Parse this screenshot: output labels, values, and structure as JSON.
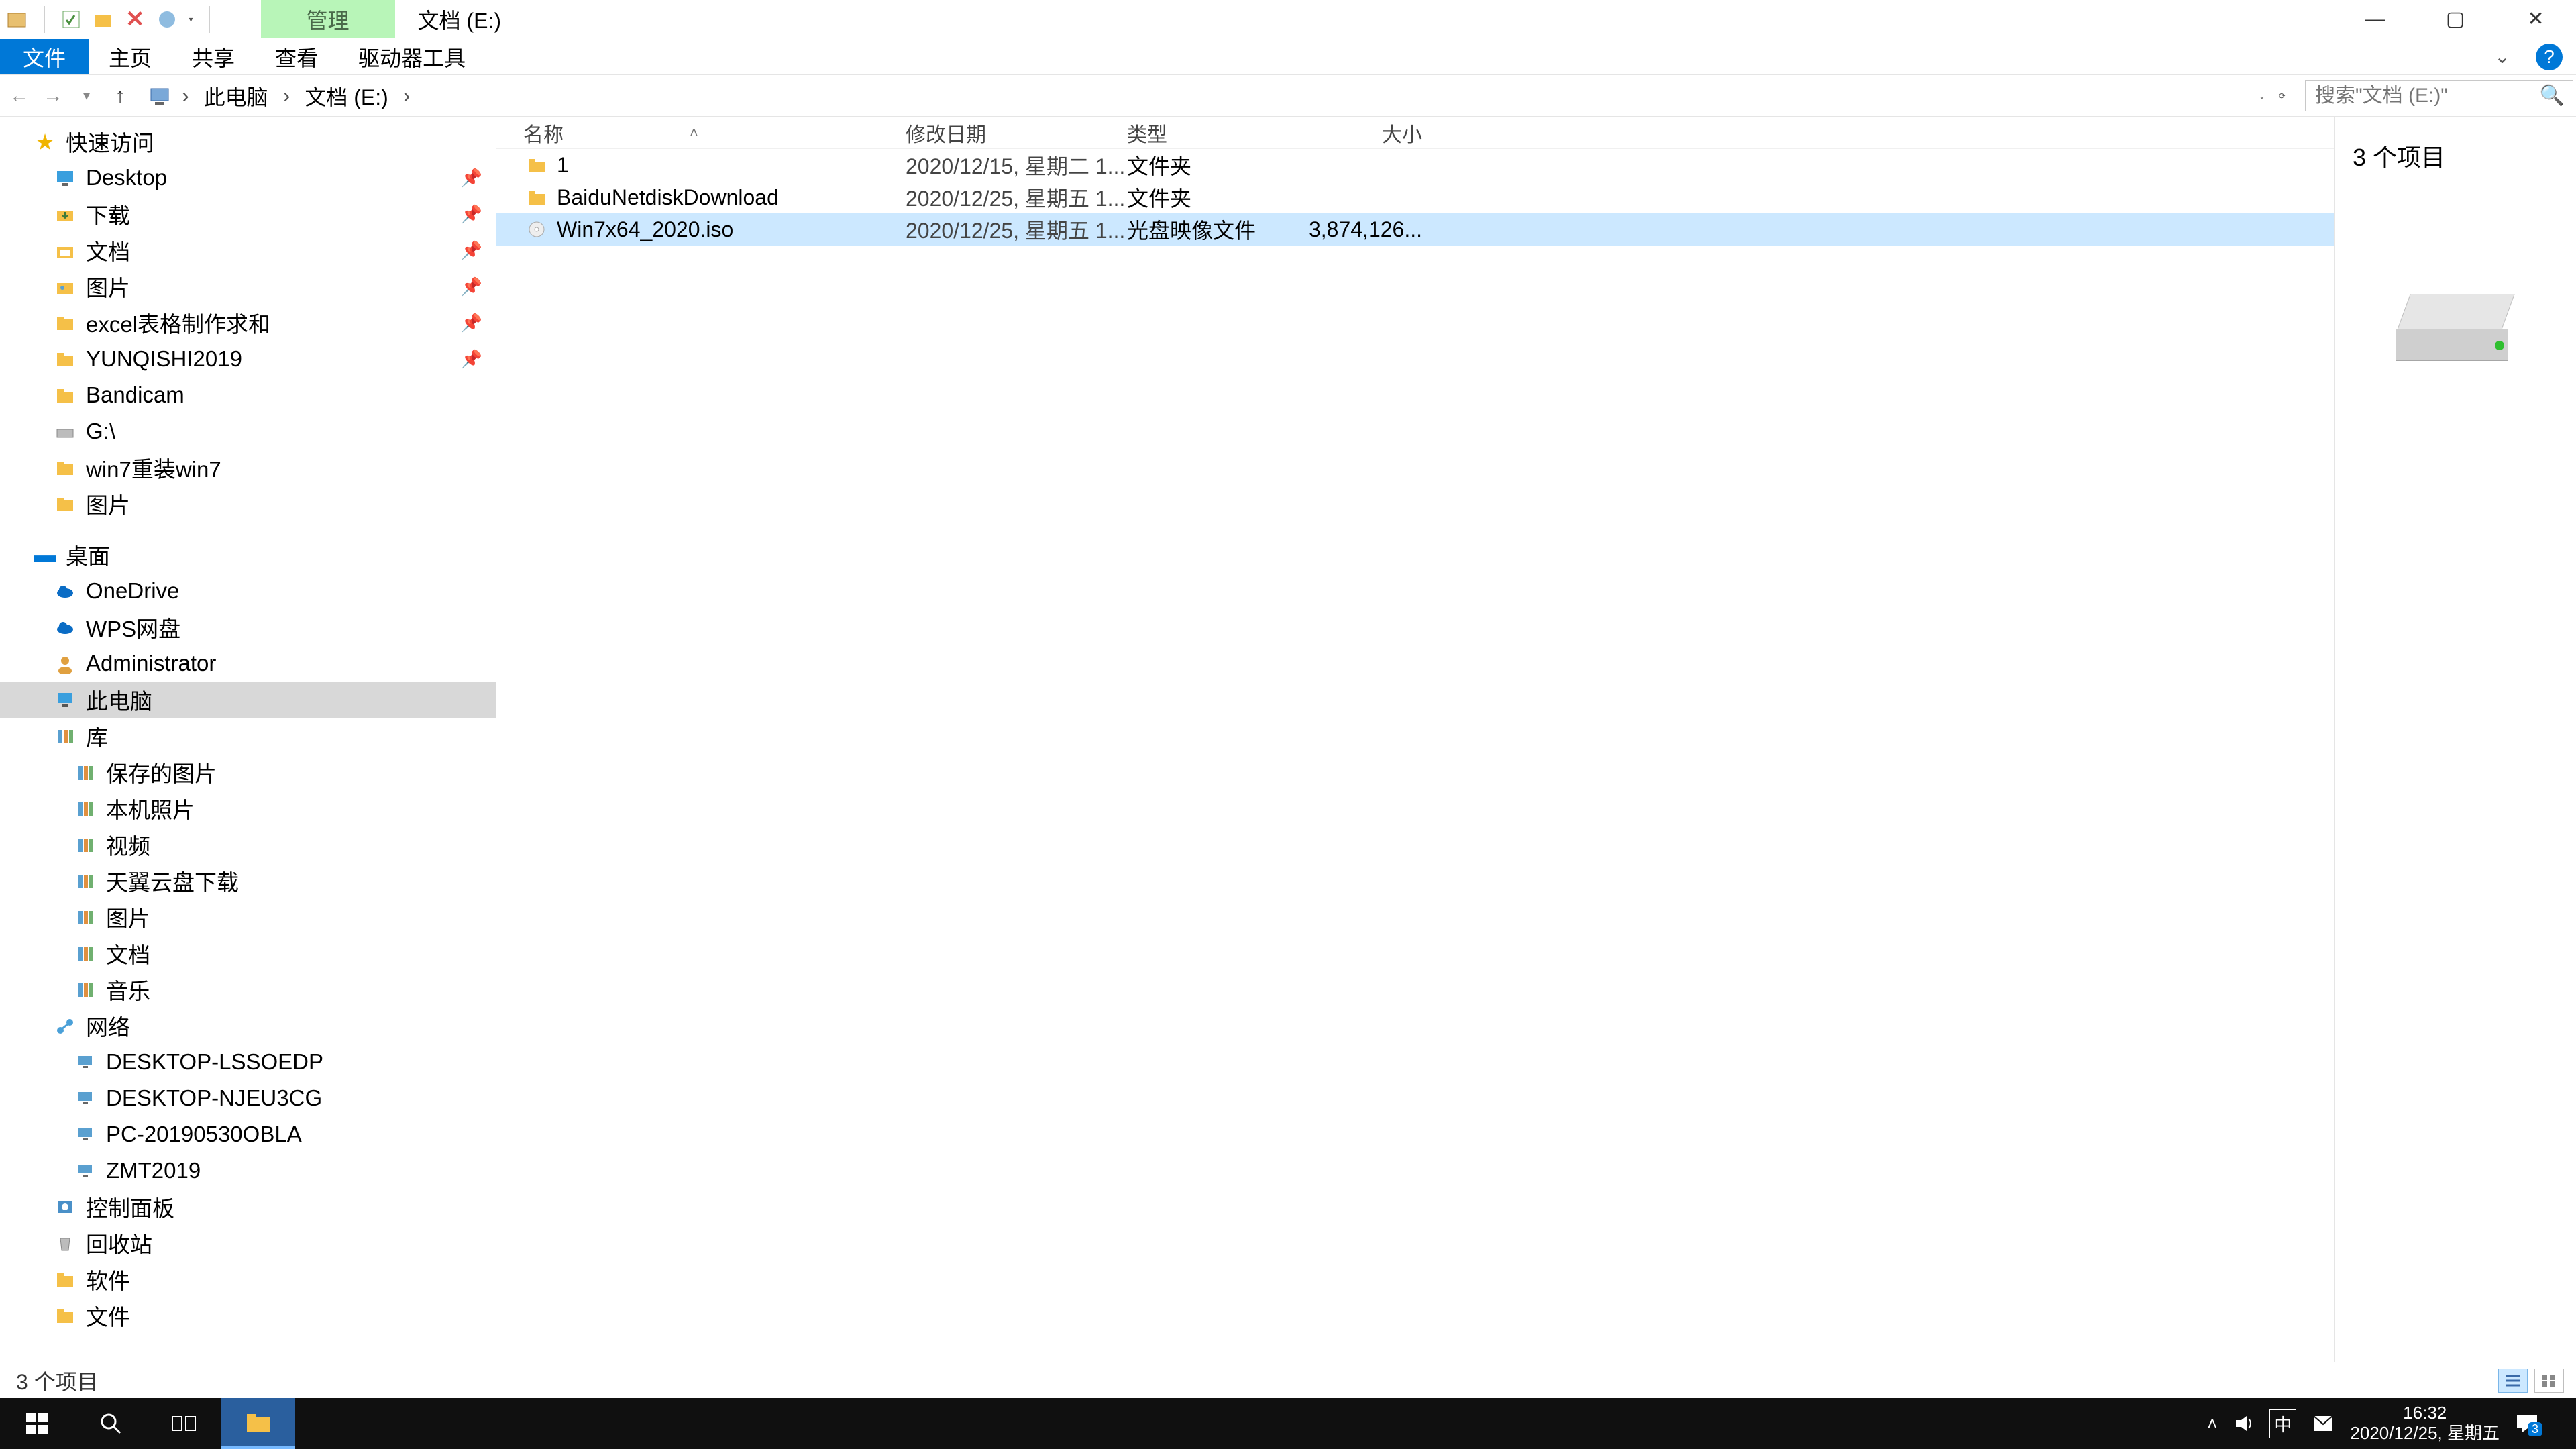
{
  "window": {
    "ctx_tab": "管理",
    "title": "文档 (E:)",
    "controls": {
      "min": "—",
      "max": "▢",
      "close": "✕"
    }
  },
  "menu": {
    "file": "文件",
    "home": "主页",
    "share": "共享",
    "view": "查看",
    "drive": "驱动器工具"
  },
  "breadcrumb": {
    "root": "此电脑",
    "here": "文档 (E:)",
    "sep": "›"
  },
  "search": {
    "placeholder": "搜索\"文档 (E:)\""
  },
  "nav": {
    "quick": "快速访问",
    "pinned": [
      {
        "l": "Desktop",
        "ico": "desktop"
      },
      {
        "l": "下载",
        "ico": "down"
      },
      {
        "l": "文档",
        "ico": "doc"
      },
      {
        "l": "图片",
        "ico": "pic"
      },
      {
        "l": "excel表格制作求和",
        "ico": "folder"
      },
      {
        "l": "YUNQISHI2019",
        "ico": "folder"
      }
    ],
    "recent": [
      {
        "l": "Bandicam",
        "ico": "folder"
      },
      {
        "l": "G:\\",
        "ico": "drive"
      },
      {
        "l": "win7重装win7",
        "ico": "folder"
      },
      {
        "l": "图片",
        "ico": "folder"
      }
    ],
    "desktop_root": "桌面",
    "desktop": [
      {
        "l": "OneDrive",
        "ico": "cloud",
        "c": "#0a6cc5"
      },
      {
        "l": "WPS网盘",
        "ico": "cloud",
        "c": "#0a6cc5"
      },
      {
        "l": "Administrator",
        "ico": "user"
      },
      {
        "l": "此电脑",
        "ico": "pc",
        "sel": true
      },
      {
        "l": "库",
        "ico": "lib"
      }
    ],
    "libs": [
      {
        "l": "保存的图片"
      },
      {
        "l": "本机照片"
      },
      {
        "l": "视频"
      },
      {
        "l": "天翼云盘下载"
      },
      {
        "l": "图片"
      },
      {
        "l": "文档"
      },
      {
        "l": "音乐"
      }
    ],
    "network": "网络",
    "net_items": [
      {
        "l": "DESKTOP-LSSOEDP"
      },
      {
        "l": "DESKTOP-NJEU3CG"
      },
      {
        "l": "PC-20190530OBLA"
      },
      {
        "l": "ZMT2019"
      }
    ],
    "tail": [
      {
        "l": "控制面板",
        "ico": "cp"
      },
      {
        "l": "回收站",
        "ico": "bin"
      },
      {
        "l": "软件",
        "ico": "folder"
      },
      {
        "l": "文件",
        "ico": "folder"
      }
    ]
  },
  "columns": {
    "name": "名称",
    "date": "修改日期",
    "type": "类型",
    "size": "大小"
  },
  "rows": [
    {
      "name": "1",
      "date": "2020/12/15, 星期二 1...",
      "type": "文件夹",
      "size": "",
      "ico": "folder",
      "sel": false
    },
    {
      "name": "BaiduNetdiskDownload",
      "date": "2020/12/25, 星期五 1...",
      "type": "文件夹",
      "size": "",
      "ico": "folder",
      "sel": false
    },
    {
      "name": "Win7x64_2020.iso",
      "date": "2020/12/25, 星期五 1...",
      "type": "光盘映像文件",
      "size": "3,874,126...",
      "ico": "iso",
      "sel": true
    }
  ],
  "preview": {
    "count": "3 个项目"
  },
  "status": {
    "text": "3 个项目"
  },
  "taskbar": {
    "time": "16:32",
    "date": "2020/12/25, 星期五",
    "ime": "中",
    "notif_count": "3"
  }
}
